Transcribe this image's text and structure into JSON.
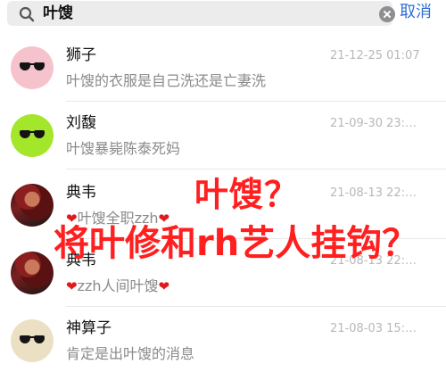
{
  "search": {
    "query": "叶馊",
    "cancel_label": "取消"
  },
  "results": [
    {
      "name": "狮子",
      "time": "21-12-25 01:07",
      "message": "叶馊的衣服是自己洗还是亡妻洗",
      "avatar": "sunglasses-pink"
    },
    {
      "name": "刘馥",
      "time": "21-09-30 23:…",
      "message": "叶馊暴毙陈泰死妈",
      "avatar": "sunglasses-green"
    },
    {
      "name": "典韦",
      "time": "21-08-13 22:…",
      "message": "叶馊全职zzh",
      "avatar": "character-portrait"
    },
    {
      "name": "典韦",
      "time": "21-08-13 22:…",
      "message": "zzh人间叶馊",
      "avatar": "character-portrait"
    },
    {
      "name": "神算子",
      "time": "21-08-03 15:…",
      "message": "肯定是出叶馊的消息",
      "avatar": "sunglasses-beige"
    }
  ],
  "overlay": {
    "line1": "叶馊？",
    "line2": "将叶修和rh艺人挂钩？"
  },
  "colors": {
    "accent": "#2f6fd6",
    "overlay_text": "#ff1f1f",
    "heart": "#e0191d",
    "avatar_pink": "#f6c2cc",
    "avatar_green": "#a4e62a",
    "avatar_beige": "#ece0c4"
  },
  "icons": {
    "search": "search-icon",
    "clear": "clear-icon",
    "heart": "heart-icon"
  }
}
